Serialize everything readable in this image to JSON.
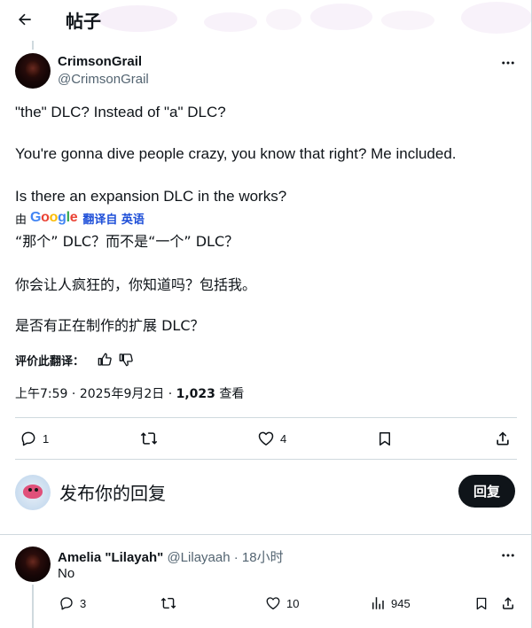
{
  "header": {
    "title": "帖子"
  },
  "post": {
    "author": {
      "name": "CrimsonGrail",
      "handle": "@CrimsonGrail"
    },
    "lines": [
      "\"the\" DLC? Instead of \"a\" DLC?",
      "You're gonna dive people crazy, you know that right? Me included.",
      "Is there an expansion DLC in the works?"
    ],
    "translate": {
      "by": "由",
      "provider": "Google",
      "link": "翻译自 英语"
    },
    "translated_lines": [
      "“那个” DLC？而不是“一个” DLC？",
      "你会让人疯狂的，你知道吗？包括我。",
      "是否有正在制作的扩展 DLC？"
    ],
    "rate_label": "评价此翻译：",
    "meta": {
      "time": "上午7:59",
      "date": "2025年9月2日",
      "views_count": "1,023",
      "views_label": "查看"
    },
    "actions": {
      "replies": "1",
      "retweets": "",
      "likes": "4"
    }
  },
  "composer": {
    "placeholder": "发布你的回复",
    "button": "回复"
  },
  "reply": {
    "name": "Amelia \"Lilayah\"",
    "handle": "@Lilayaah",
    "time": "18小时",
    "text": "No",
    "actions": {
      "replies": "3",
      "likes": "10",
      "views": "945"
    }
  },
  "colors": {
    "text": "#0f1419",
    "secondary": "#536471",
    "border": "#cfd9de",
    "link": "#1d4ed8",
    "google_blue": "#4285F4",
    "google_red": "#EA4335",
    "google_yellow": "#FBBC05",
    "google_green": "#34A853"
  }
}
